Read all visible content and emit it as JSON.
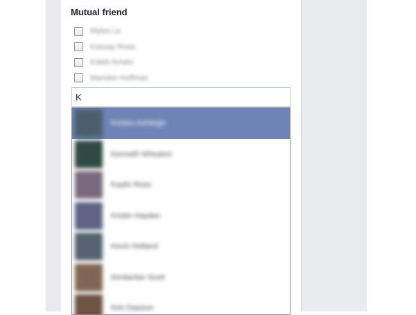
{
  "mutual_friend": {
    "title": "Mutual friend",
    "checkbox_labels": [
      "Myles Le",
      "Kassay Rosa",
      "Kaleb Amato",
      "Mandee Hoffman"
    ],
    "search_value": "K",
    "suggestions": [
      {
        "name": "Kristen Ashleigh",
        "avatar_color": "#4c5e6e",
        "highlighted": true
      },
      {
        "name": "Kenneth Wheaton",
        "avatar_color": "#2f4a44",
        "highlighted": false
      },
      {
        "name": "Kaylin Ross",
        "avatar_color": "#7a6a7e",
        "highlighted": false
      },
      {
        "name": "Kristin Hayden",
        "avatar_color": "#5d6486",
        "highlighted": false
      },
      {
        "name": "Kevin Holland",
        "avatar_color": "#556270",
        "highlighted": false
      },
      {
        "name": "Kimberlee Scott",
        "avatar_color": "#806654",
        "highlighted": false
      },
      {
        "name": "Kirk Dawson",
        "avatar_color": "#6e5244",
        "highlighted": false
      }
    ]
  },
  "colors": {
    "highlight": "#6d84b4",
    "page_background": "#e9ebee"
  }
}
